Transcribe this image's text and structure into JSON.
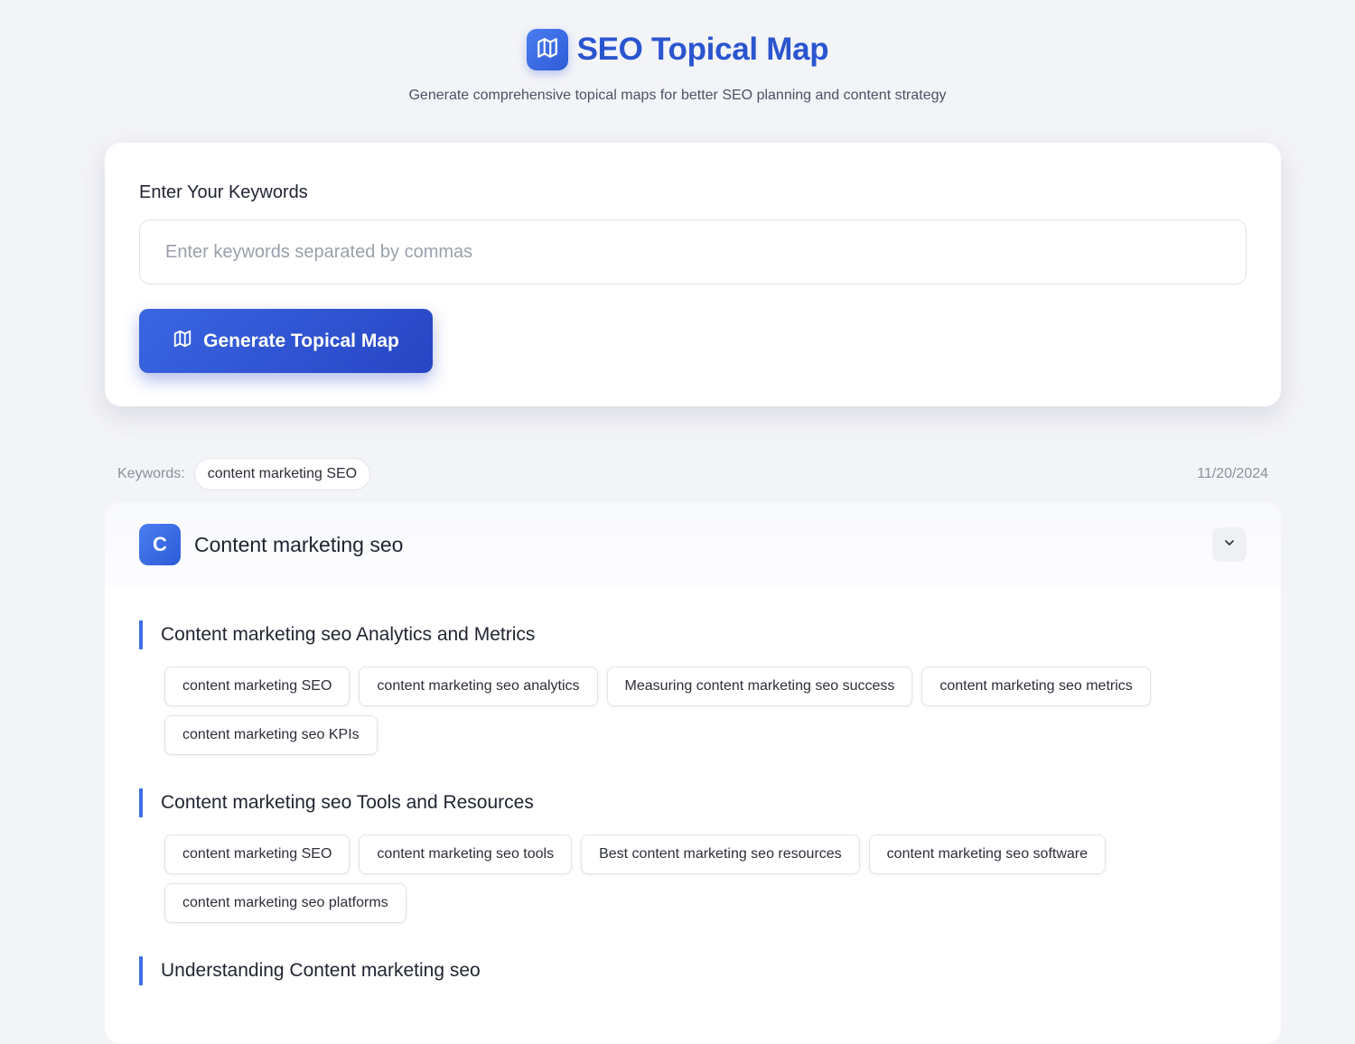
{
  "header": {
    "title": "SEO Topical Map",
    "subtitle": "Generate comprehensive topical maps for better SEO planning and content strategy",
    "logo_icon": "map-icon"
  },
  "input_card": {
    "label": "Enter Your Keywords",
    "input_value": "",
    "input_placeholder": "Enter keywords separated by commas",
    "button_label": "Generate Topical Map",
    "button_icon": "map-icon"
  },
  "result_meta": {
    "keywords_label": "Keywords:",
    "keywords": [
      "content marketing SEO"
    ],
    "date": "11/20/2024"
  },
  "result": {
    "badge_letter": "C",
    "title": "Content marketing seo",
    "collapse_icon": "chevron-down-icon",
    "sections": [
      {
        "heading": "Content marketing seo Analytics and Metrics",
        "chips": [
          "content marketing SEO",
          "content marketing seo analytics",
          "Measuring content marketing seo success",
          "content marketing seo metrics",
          "content marketing seo KPIs"
        ]
      },
      {
        "heading": "Content marketing seo Tools and Resources",
        "chips": [
          "content marketing SEO",
          "content marketing seo tools",
          "Best content marketing seo resources",
          "content marketing seo software",
          "content marketing seo platforms"
        ]
      },
      {
        "heading": "Understanding Content marketing seo",
        "chips": []
      }
    ]
  },
  "colors": {
    "accent": "#2a55cf",
    "button": "#2e55d4",
    "background": "#f3f4f8",
    "section_bar": "#3f6fe4"
  }
}
